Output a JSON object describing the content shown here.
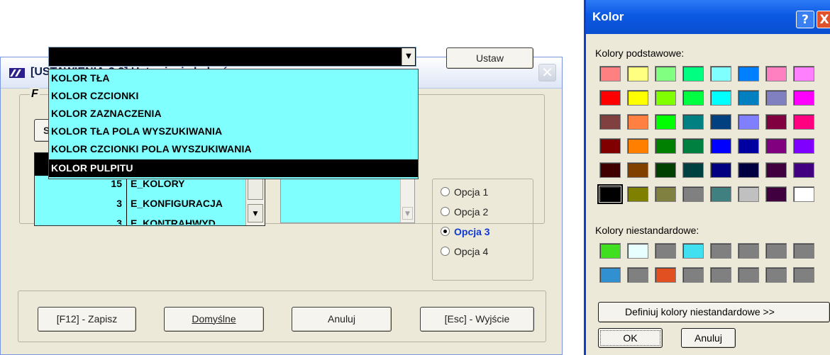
{
  "settings_window": {
    "title": "[USTAWIENIA:3.2]  Ustawienia kolorów",
    "set_button": "Ustaw",
    "group_title_partial": "F",
    "left_button_partial": "S",
    "dropdown_items": [
      "KOLOR TŁA",
      "KOLOR CZCIONKI",
      "KOLOR ZAZNACZENIA",
      "KOLOR TŁA POLA WYSZUKIWANIA",
      "KOLOR CZCIONKI POLA WYSZUKIWANIA",
      "KOLOR PULPITU"
    ],
    "selected_dropdown_item": "KOLOR PULPITU",
    "list_rows": [
      {
        "num": "15",
        "name": "E_KOLORY"
      },
      {
        "num": "3",
        "name": "E_KONFIGURACJA"
      },
      {
        "num": "3",
        "name": "E_KONTRAHWYD"
      }
    ],
    "options": [
      "Opcja 1",
      "Opcja 2",
      "Opcja 3",
      "Opcja 4"
    ],
    "selected_option": "Opcja 3",
    "buttons": {
      "save": "[F12] - Zapisz",
      "default": "Domyślne",
      "cancel": "Anuluj",
      "exit": "[Esc] - Wyjście"
    },
    "colors": {
      "list_bg": "#80ffff",
      "selected_bg": "#000000"
    }
  },
  "color_dialog": {
    "title": "Kolor",
    "help_glyph": "?",
    "close_glyph": "X",
    "basic_label": "Kolory podstawowe:",
    "custom_label": "Kolory niestandardowe:",
    "basic_colors": [
      [
        "#ff8080",
        "#ffff80",
        "#80ff80",
        "#00ff80",
        "#80ffff",
        "#0080ff",
        "#ff80c0",
        "#ff80ff"
      ],
      [
        "#ff0000",
        "#ffff00",
        "#80ff00",
        "#00ff40",
        "#00ffff",
        "#0080c0",
        "#8080c0",
        "#ff00ff"
      ],
      [
        "#804040",
        "#ff8040",
        "#00ff00",
        "#008080",
        "#004080",
        "#8080ff",
        "#800040",
        "#ff0080"
      ],
      [
        "#800000",
        "#ff8000",
        "#008000",
        "#008040",
        "#0000ff",
        "#0000a0",
        "#800080",
        "#8000ff"
      ],
      [
        "#400000",
        "#804000",
        "#004000",
        "#004040",
        "#000080",
        "#000040",
        "#400040",
        "#400080"
      ],
      [
        "#000000",
        "#808000",
        "#808040",
        "#808080",
        "#408080",
        "#c0c0c0",
        "#400040",
        "#ffffff"
      ]
    ],
    "selected_basic": "#000000",
    "custom_colors": [
      [
        "#40e020",
        "#e8ffff",
        "#808080",
        "#40e0f0",
        "#808080",
        "#808080",
        "#808080",
        "#808080"
      ],
      [
        "#3090d0",
        "#808080",
        "#e05020",
        "#808080",
        "#808080",
        "#808080",
        "#808080",
        "#808080"
      ]
    ],
    "define_button": "Definiuj kolory niestandardowe >>",
    "ok_button": "OK",
    "cancel_button": "Anuluj"
  }
}
